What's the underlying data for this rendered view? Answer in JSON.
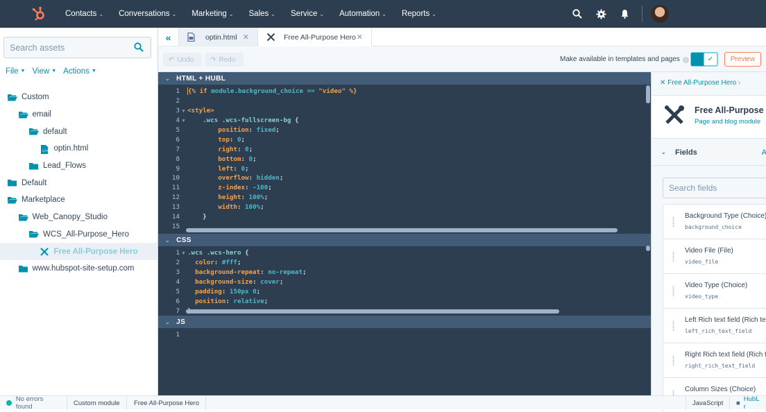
{
  "topnav": {
    "items": [
      {
        "label": "Contacts"
      },
      {
        "label": "Conversations"
      },
      {
        "label": "Marketing"
      },
      {
        "label": "Sales"
      },
      {
        "label": "Service"
      },
      {
        "label": "Automation"
      },
      {
        "label": "Reports"
      }
    ],
    "icons": [
      "search-icon",
      "gear-icon",
      "bell-icon"
    ],
    "brand_color": "#ff7a59",
    "bg_color": "#2d3e50"
  },
  "sidebar": {
    "search_placeholder": "Search assets",
    "menus": [
      "File",
      "View",
      "Actions"
    ],
    "tree": [
      {
        "label": "Custom",
        "depth": 0,
        "icon": "folder-open-icon"
      },
      {
        "label": "email",
        "depth": 1,
        "icon": "folder-open-icon"
      },
      {
        "label": "default",
        "depth": 2,
        "icon": "folder-open-icon"
      },
      {
        "label": "optin.html",
        "depth": 3,
        "icon": "html-file-icon"
      },
      {
        "label": "Lead_Flows",
        "depth": 2,
        "icon": "folder-icon"
      },
      {
        "label": "Default",
        "depth": 0,
        "icon": "folder-icon"
      },
      {
        "label": "Marketplace",
        "depth": 0,
        "icon": "folder-open-icon"
      },
      {
        "label": "Web_Canopy_Studio",
        "depth": 1,
        "icon": "folder-open-icon"
      },
      {
        "label": "WCS_All-Purpose_Hero",
        "depth": 2,
        "icon": "folder-open-icon"
      },
      {
        "label": "Free All-Purpose Hero",
        "depth": 3,
        "icon": "module-icon",
        "selected": true
      },
      {
        "label": "www.hubspot-site-setup.com",
        "depth": 1,
        "icon": "folder-icon"
      }
    ]
  },
  "tabs": [
    {
      "label": "optin.html",
      "icon": "html-file-icon",
      "active": false
    },
    {
      "label": "Free All-Purpose Hero",
      "icon": "module-icon",
      "active": true
    }
  ],
  "toolbar": {
    "undo": "Undo",
    "redo": "Redo",
    "availability_label": "Make available in templates and pages",
    "availability_on": true,
    "preview": "Preview"
  },
  "editor": {
    "sections": [
      {
        "title": "HTML + HUBL",
        "lines": [
          "{% if module.background_choice == \"video\" %}",
          "",
          "<style>",
          "    .wcs .wcs-fullscreen-bg {",
          "        position: fixed;",
          "        top: 0;",
          "        right: 0;",
          "        bottom: 0;",
          "        left: 0;",
          "        overflow: hidden;",
          "        z-index: -100;",
          "        height: 100%;",
          "        width: 100%;",
          "    }",
          ""
        ]
      },
      {
        "title": "CSS",
        "lines": [
          ".wcs .wcs-hero {",
          "  color: #fff;",
          "  background-repeat: no-repeat;",
          "  background-size: cover;",
          "  padding: 150px 0;",
          "  position: relative;",
          "}"
        ]
      },
      {
        "title": "JS",
        "lines": [
          ""
        ]
      }
    ]
  },
  "rightpanel": {
    "breadcrumb": "Free All-Purpose Hero",
    "module_title": "Free All-Purpose Hero",
    "module_subtitle": "Page and blog module",
    "fields_header": "Fields",
    "fields_action": "A",
    "search_placeholder": "Search fields",
    "fields": [
      {
        "label": "Background Type (Choice)",
        "name": "background_choice"
      },
      {
        "label": "Video File (File)",
        "name": "video_file"
      },
      {
        "label": "Video Type (Choice)",
        "name": "video_type"
      },
      {
        "label": "Left Rich text field (Rich text)",
        "name": "left_rich_text_field"
      },
      {
        "label": "Right Rich text field (Rich text)",
        "name": "right_rich_text_field"
      },
      {
        "label": "Column Sizes (Choice)",
        "name": ""
      }
    ]
  },
  "statusbar": {
    "errors": "No errors found",
    "type": "Custom module",
    "name": "Free All-Purpose Hero",
    "language": "JavaScript",
    "reference": "HubL r"
  }
}
